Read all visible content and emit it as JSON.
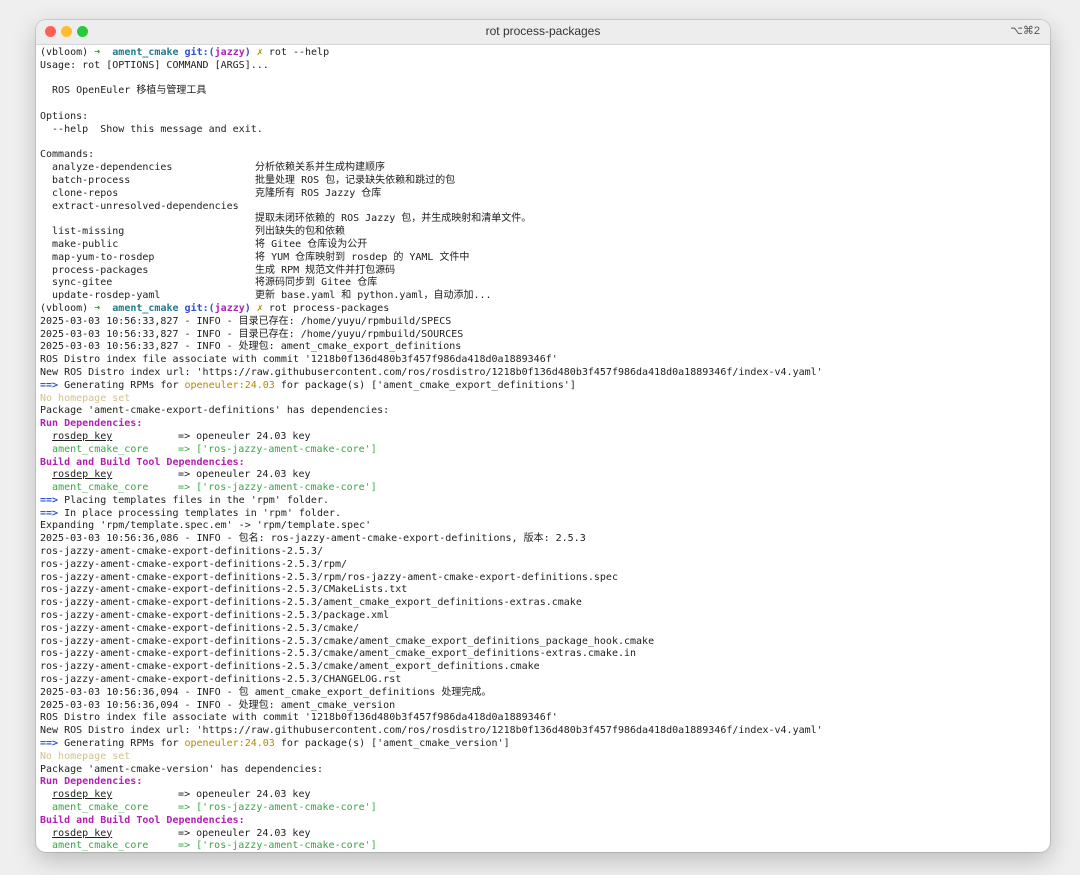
{
  "window": {
    "title": "rot process-packages",
    "shortcut": "⌥⌘2"
  },
  "prompt": {
    "env": "(vbloom)",
    "arrow": "➜",
    "dir": "ament_cmake",
    "git_label": "git:(",
    "branch": "jazzy",
    "git_close": ")",
    "dirty": "✗"
  },
  "help": {
    "command": "rot --help",
    "usage": "Usage: rot [OPTIONS] COMMAND [ARGS]...",
    "description": "  ROS OpenEuler 移植与管理工具",
    "options_header": "Options:",
    "option_help": "  --help  Show this message and exit.",
    "commands_header": "Commands:",
    "commands": [
      {
        "name": "analyze-dependencies",
        "desc": "分析依赖关系并生成构建顺序"
      },
      {
        "name": "batch-process",
        "desc": "批量处理 ROS 包，记录缺失依赖和跳过的包"
      },
      {
        "name": "clone-repos",
        "desc": "克隆所有 ROS Jazzy 仓库"
      },
      {
        "name": "extract-unresolved-dependencies",
        "desc": ""
      },
      {
        "name": "",
        "desc": "提取未闭环依赖的 ROS Jazzy 包，并生成映射和清单文件。"
      },
      {
        "name": "list-missing",
        "desc": "列出缺失的包和依赖"
      },
      {
        "name": "make-public",
        "desc": "将 Gitee 仓库设为公开"
      },
      {
        "name": "map-yum-to-rosdep",
        "desc": "将 YUM 仓库映射到 rosdep 的 YAML 文件中"
      },
      {
        "name": "process-packages",
        "desc": "生成 RPM 规范文件并打包源码"
      },
      {
        "name": "sync-gitee",
        "desc": "将源码同步到 Gitee 仓库"
      },
      {
        "name": "update-rosdep-yaml",
        "desc": "更新 base.yaml 和 python.yaml，自动添加..."
      }
    ]
  },
  "run": {
    "command": "rot process-packages",
    "log_specs": "2025-03-03 10:56:33,827 - INFO - 目录已存在: /home/yuyu/rpmbuild/SPECS",
    "log_sources": "2025-03-03 10:56:33,827 - INFO - 目录已存在: /home/yuyu/rpmbuild/SOURCES",
    "log_processing1": "2025-03-03 10:56:33,827 - INFO - 处理包: ament_cmake_export_definitions",
    "commit1": "ROS Distro index file associate with commit '1218b0f136d480b3f457f986da418d0a1889346f'",
    "index1": "New ROS Distro index url: 'https://raw.githubusercontent.com/ros/rosdistro/1218b0f136d480b3f457f986da418d0a1889346f/index-v4.yaml'",
    "gen_arrow": "==>",
    "gen_prefix": " Generating RPMs for ",
    "os_tag": "openeuler:24.03",
    "gen_pkg1": " for package(s) ['ament_cmake_export_definitions']",
    "no_homepage": "No homepage set",
    "has_deps1": "Package 'ament-cmake-export-definitions' has dependencies:",
    "run_deps": "Run Dependencies:",
    "rosdep_key": "rosdep key",
    "rosdep_target": "=> openeuler 24.03 key",
    "core_dep": "ament_cmake_core",
    "core_target": "=> ['ros-jazzy-ament-cmake-core']",
    "build_deps": "Build and Build Tool Dependencies:",
    "placing": " Placing templates files in the 'rpm' folder.",
    "inplace": " In place processing templates in 'rpm' folder.",
    "expanding": "Expanding 'rpm/template.spec.em' -> 'rpm/template.spec'",
    "log_pkgname": "2025-03-03 10:56:36,086 - INFO - 包名: ros-jazzy-ament-cmake-export-definitions, 版本: 2.5.3",
    "tar_files": [
      "ros-jazzy-ament-cmake-export-definitions-2.5.3/",
      "ros-jazzy-ament-cmake-export-definitions-2.5.3/rpm/",
      "ros-jazzy-ament-cmake-export-definitions-2.5.3/rpm/ros-jazzy-ament-cmake-export-definitions.spec",
      "ros-jazzy-ament-cmake-export-definitions-2.5.3/CMakeLists.txt",
      "ros-jazzy-ament-cmake-export-definitions-2.5.3/ament_cmake_export_definitions-extras.cmake",
      "ros-jazzy-ament-cmake-export-definitions-2.5.3/package.xml",
      "ros-jazzy-ament-cmake-export-definitions-2.5.3/cmake/",
      "ros-jazzy-ament-cmake-export-definitions-2.5.3/cmake/ament_cmake_export_definitions_package_hook.cmake",
      "ros-jazzy-ament-cmake-export-definitions-2.5.3/cmake/ament_cmake_export_definitions-extras.cmake.in",
      "ros-jazzy-ament-cmake-export-definitions-2.5.3/cmake/ament_export_definitions.cmake",
      "ros-jazzy-ament-cmake-export-definitions-2.5.3/CHANGELOG.rst"
    ],
    "log_done": "2025-03-03 10:56:36,094 - INFO - 包 ament_cmake_export_definitions 处理完成。",
    "log_processing2": "2025-03-03 10:56:36,094 - INFO - 处理包: ament_cmake_version",
    "commit2": "ROS Distro index file associate with commit '1218b0f136d480b3f457f986da418d0a1889346f'",
    "index2": "New ROS Distro index url: 'https://raw.githubusercontent.com/ros/rosdistro/1218b0f136d480b3f457f986da418d0a1889346f/index-v4.yaml'",
    "gen_pkg2": " for package(s) ['ament_cmake_version']",
    "has_deps2": "Package 'ament-cmake-version' has dependencies:"
  },
  "colors": {
    "close": "#ff5f57",
    "minimize": "#febc2e",
    "maximize": "#28c840",
    "prompt_arrow": "#2aa52a",
    "git_label": "#2f4fd8",
    "section_header": "#b21fb2",
    "dep_name": "#3aa545",
    "os_tag": "#b58900"
  }
}
